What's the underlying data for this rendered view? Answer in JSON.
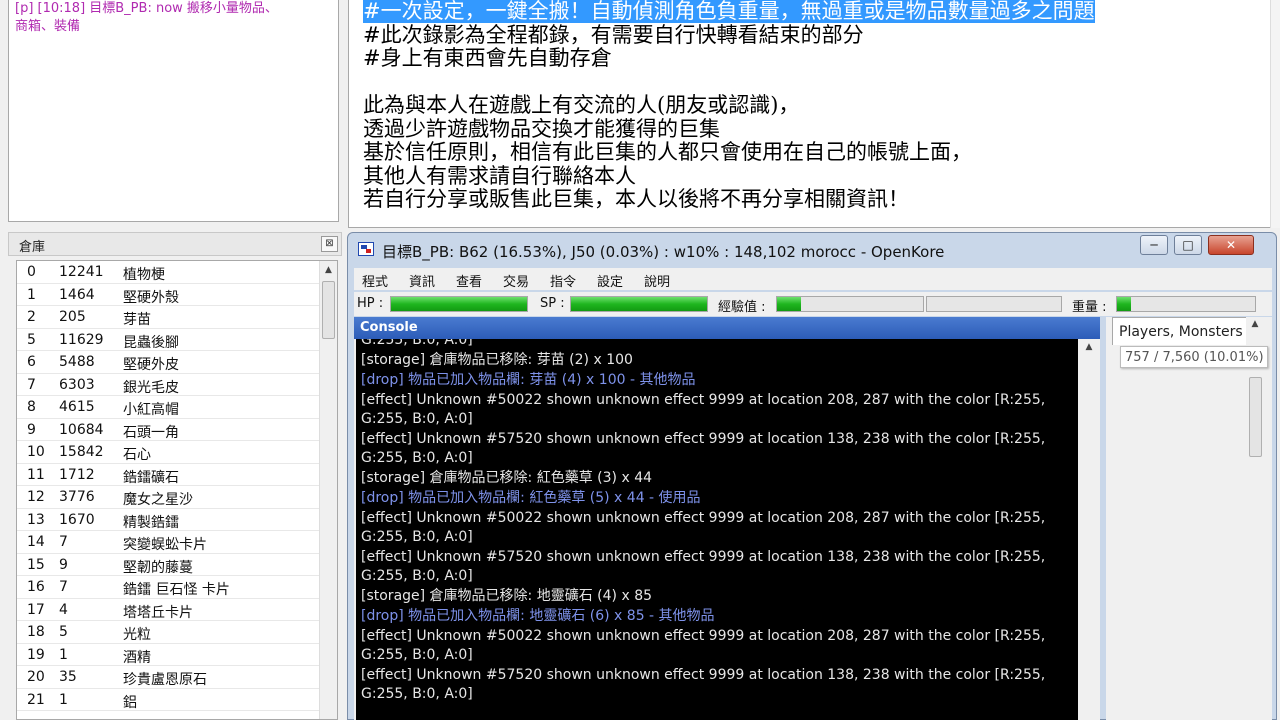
{
  "chat": {
    "lines": [
      "[p] [10:18] 目標B_PB: now 搬移小量物品、",
      "商箱、裝備"
    ]
  },
  "description": {
    "lines": [
      "#一次設定，一鍵全搬！自動偵測角色負重量，無過重或是物品數量過多之問題",
      "#此次錄影為全程都錄，有需要自行快轉看結束的部分",
      "#身上有東西會先自動存倉",
      "",
      "此為與本人在遊戲上有交流的人(朋友或認識)，",
      "透過少許遊戲物品交換才能獲得的巨集",
      "基於信任原則，相信有此巨集的人都只會使用在自己的帳號上面，",
      "其他人有需求請自行聯絡本人",
      "若自行分享或販售此巨集，本人以後將不再分享相關資訊！"
    ]
  },
  "storage": {
    "title": "倉庫",
    "close_label": "⊠",
    "items": [
      {
        "id": "0",
        "qty": "12241",
        "name": "植物梗"
      },
      {
        "id": "1",
        "qty": "1464",
        "name": "堅硬外殼"
      },
      {
        "id": "2",
        "qty": "205",
        "name": "芽苗"
      },
      {
        "id": "5",
        "qty": "11629",
        "name": "昆蟲後腳"
      },
      {
        "id": "6",
        "qty": "5488",
        "name": "堅硬外皮"
      },
      {
        "id": "7",
        "qty": "6303",
        "name": "銀光毛皮"
      },
      {
        "id": "8",
        "qty": "4615",
        "name": "小紅高帽"
      },
      {
        "id": "9",
        "qty": "10684",
        "name": "石頭一角"
      },
      {
        "id": "10",
        "qty": "15842",
        "name": "石心"
      },
      {
        "id": "11",
        "qty": "1712",
        "name": "鋯鐳礦石"
      },
      {
        "id": "12",
        "qty": "3776",
        "name": "魔女之星沙"
      },
      {
        "id": "13",
        "qty": "1670",
        "name": "精製鋯鐳"
      },
      {
        "id": "14",
        "qty": "7",
        "name": "突變蜈蚣卡片"
      },
      {
        "id": "15",
        "qty": "9",
        "name": "堅韌的藤蔓"
      },
      {
        "id": "16",
        "qty": "7",
        "name": "鋯鐳 巨石怪 卡片"
      },
      {
        "id": "17",
        "qty": "4",
        "name": "塔塔丘卡片"
      },
      {
        "id": "18",
        "qty": "5",
        "name": "光粒"
      },
      {
        "id": "19",
        "qty": "1",
        "name": "酒精"
      },
      {
        "id": "20",
        "qty": "35",
        "name": "珍貴盧恩原石"
      },
      {
        "id": "21",
        "qty": "1",
        "name": "鋁"
      }
    ]
  },
  "openkore": {
    "title": "目標B_PB:  B62 (16.53%), J50 (0.03%) : w10% : 148,102 morocc - OpenKore",
    "window_buttons": {
      "minimize": "─",
      "maximize": "□",
      "close": "✕"
    },
    "menu": [
      "程式",
      "資訊",
      "查看",
      "交易",
      "指令",
      "設定",
      "說明"
    ],
    "stats": {
      "hp_label": "HP :",
      "sp_label": "SP :",
      "exp_label": "經驗值 :",
      "weight_label": "重量 :",
      "hp_fill": 1.0,
      "sp_fill": 1.0,
      "base_exp_fill": 0.165,
      "job_exp_fill": 0.0,
      "weight_fill": 0.1
    },
    "console": {
      "title": "Console",
      "lines": [
        {
          "text": "G:255, B:0, A:0]",
          "color": "white",
          "cut": true
        },
        {
          "text": "[storage] 倉庫物品已移除: 芽苗 (2) x 100",
          "color": "white"
        },
        {
          "text": "[drop] 物品已加入物品欄: 芽苗 (4) x 100 - 其他物品",
          "color": "blue"
        },
        {
          "text": "[effect] Unknown #50022 shown unknown effect 9999 at location 208, 287 with the color [R:255,\nG:255, B:0, A:0]",
          "color": "white"
        },
        {
          "text": "[effect] Unknown #57520 shown unknown effect 9999 at location 138, 238 with the color [R:255,\nG:255, B:0, A:0]",
          "color": "white"
        },
        {
          "text": "[storage] 倉庫物品已移除: 紅色藥草 (3) x 44",
          "color": "white"
        },
        {
          "text": "[drop] 物品已加入物品欄: 紅色藥草 (5) x 44 - 使用品",
          "color": "blue"
        },
        {
          "text": "[effect] Unknown #50022 shown unknown effect 9999 at location 208, 287 with the color [R:255,\nG:255, B:0, A:0]",
          "color": "white"
        },
        {
          "text": "[effect] Unknown #57520 shown unknown effect 9999 at location 138, 238 with the color [R:255,\nG:255, B:0, A:0]",
          "color": "white"
        },
        {
          "text": "[storage] 倉庫物品已移除: 地靈礦石 (4) x 85",
          "color": "white"
        },
        {
          "text": "[drop] 物品已加入物品欄: 地靈礦石 (6) x 85 - 其他物品",
          "color": "blue"
        },
        {
          "text": "[effect] Unknown #50022 shown unknown effect 9999 at location 208, 287 with the color [R:255,\nG:255, B:0, A:0]",
          "color": "white"
        },
        {
          "text": "[effect] Unknown #57520 shown unknown effect 9999 at location 138, 238 with the color [R:255,\nG:255, B:0, A:0]",
          "color": "white"
        }
      ]
    },
    "side": {
      "tab_label": "Players, Monsters",
      "tooltip": "757 / 7,560 (10.01%)"
    }
  },
  "colors": {
    "highlight": "#3399ff",
    "bar_green": "#1fb61f",
    "console_header": "#2c5cb8",
    "log_white": "#e6e6e6",
    "log_blue": "#7e92ea",
    "chat_magenta": "#b02ab0"
  }
}
